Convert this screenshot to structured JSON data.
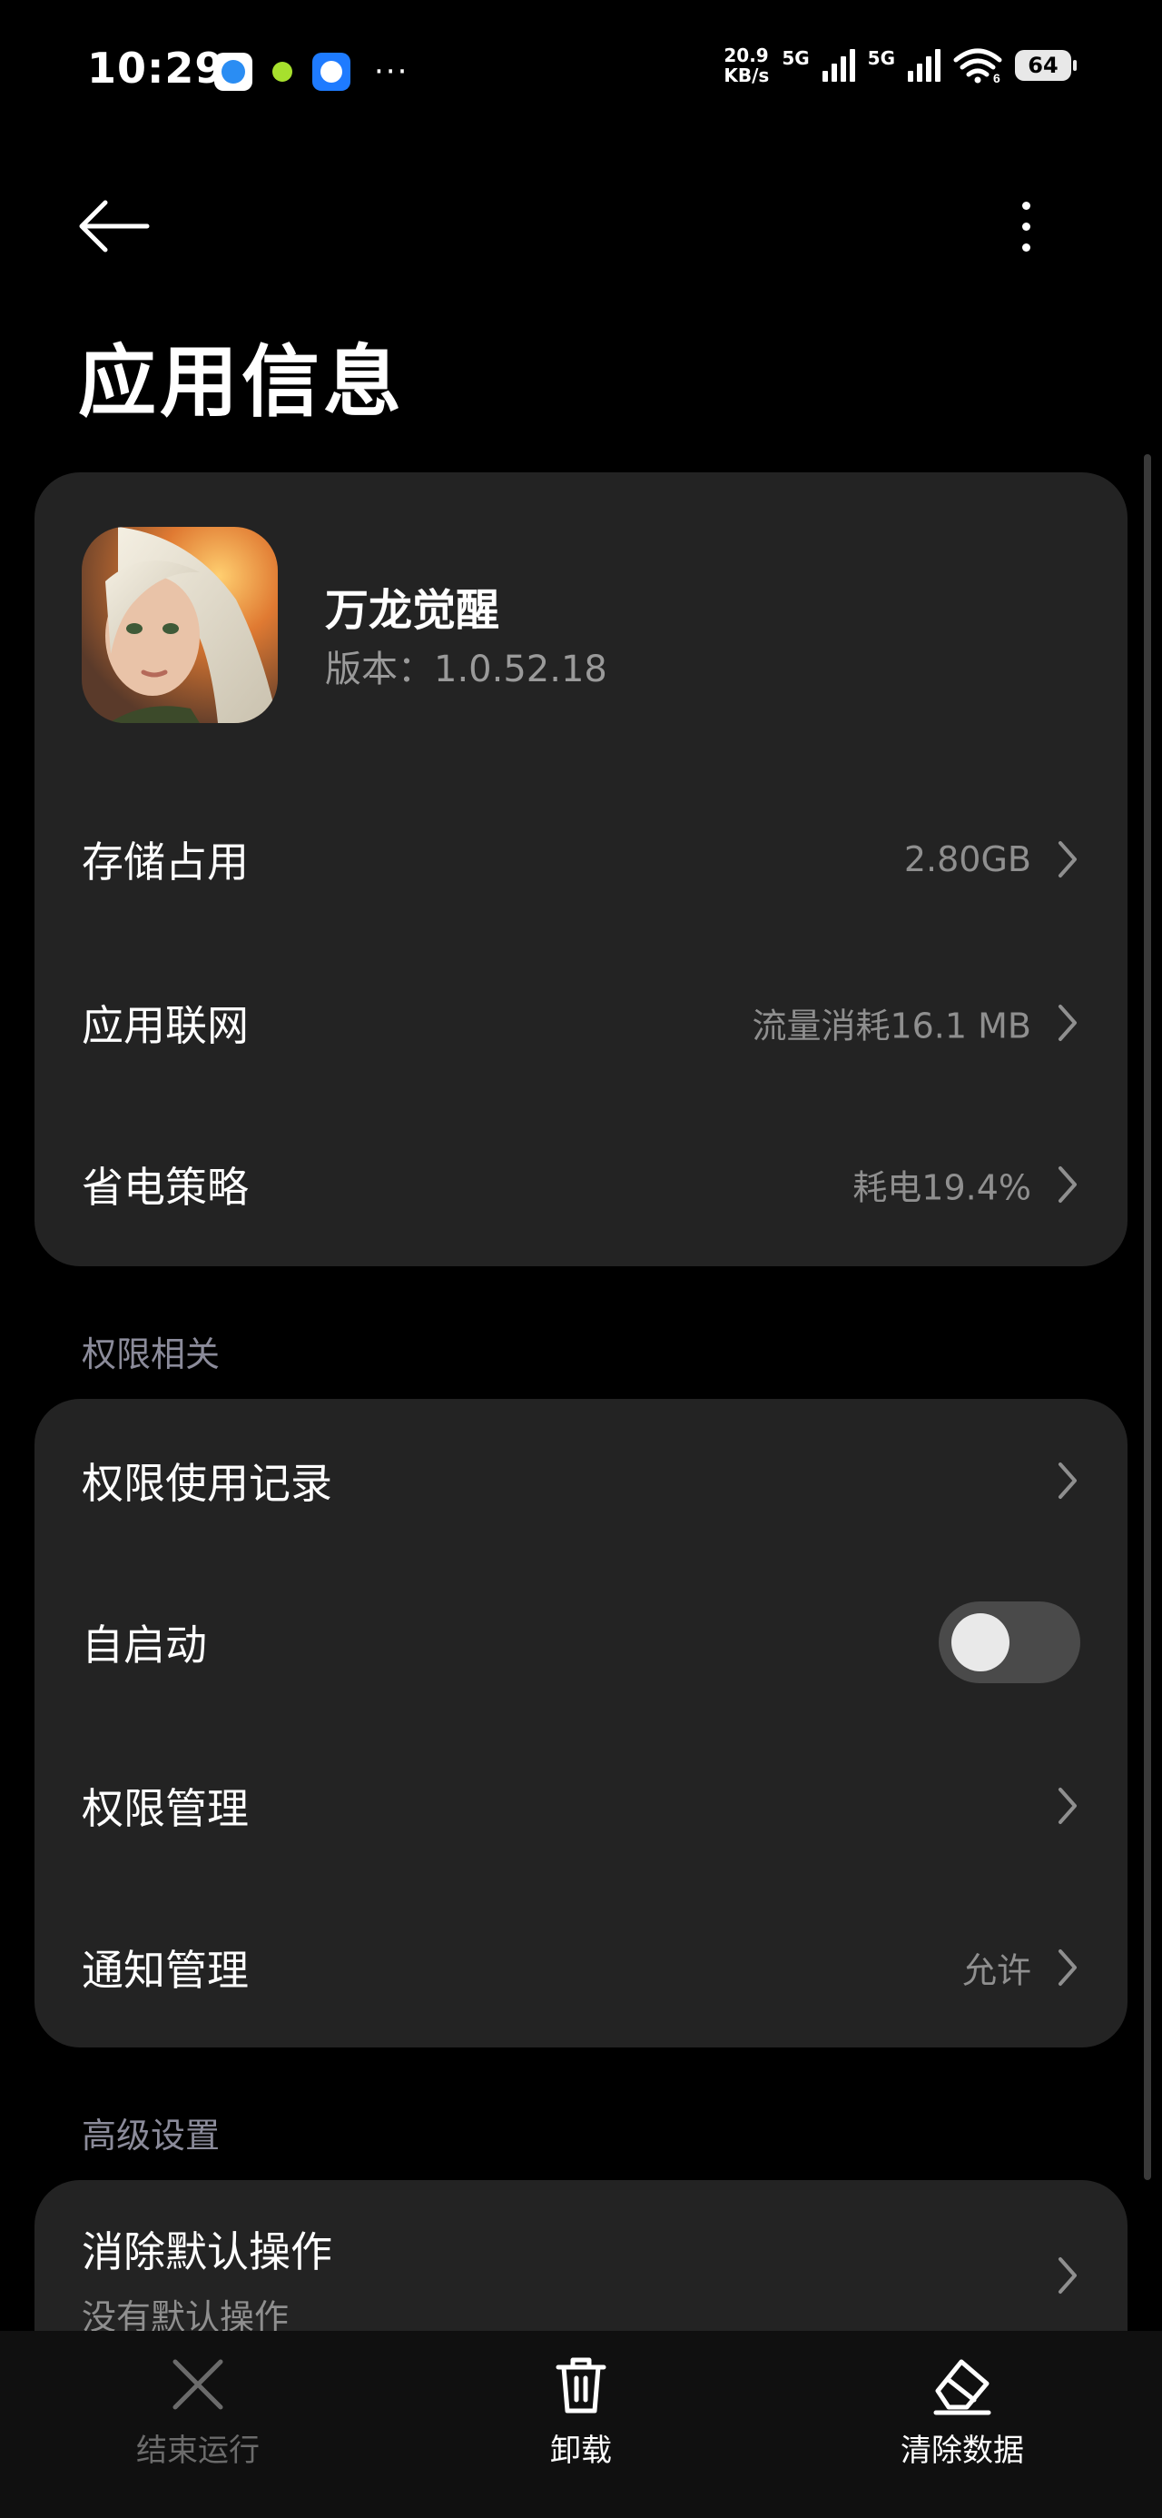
{
  "status_bar": {
    "time": "10:29",
    "net_speed_value": "20.9",
    "net_speed_unit": "KB/s",
    "signal1_label": "5G",
    "signal2_label": "5G",
    "wifi_badge": "6",
    "battery": "64"
  },
  "header": {
    "title": "应用信息"
  },
  "app": {
    "name": "万龙觉醒",
    "version": "版本：1.0.52.18"
  },
  "app_rows": [
    {
      "label": "存储占用",
      "value": "2.80GB"
    },
    {
      "label": "应用联网",
      "value": "流量消耗16.1 MB"
    },
    {
      "label": "省电策略",
      "value": "耗电19.4%"
    }
  ],
  "permissions": {
    "section_label": "权限相关",
    "usage_record": "权限使用记录",
    "auto_start": "自启动",
    "auto_start_enabled": false,
    "manage": "权限管理",
    "notification": "通知管理",
    "notification_value": "允许"
  },
  "advanced": {
    "section_label": "高级设置",
    "clear_defaults": "消除默认操作",
    "clear_defaults_sub": "没有默认操作"
  },
  "bottom_actions": {
    "force_stop": "结束运行",
    "uninstall": "卸载",
    "clear_data": "清除数据"
  },
  "colors": {
    "background": "#000000",
    "card": "#232323",
    "secondary_text": "#8f8f8f",
    "section_text": "#8b8b9a",
    "disabled_text": "#6b6b6b"
  }
}
